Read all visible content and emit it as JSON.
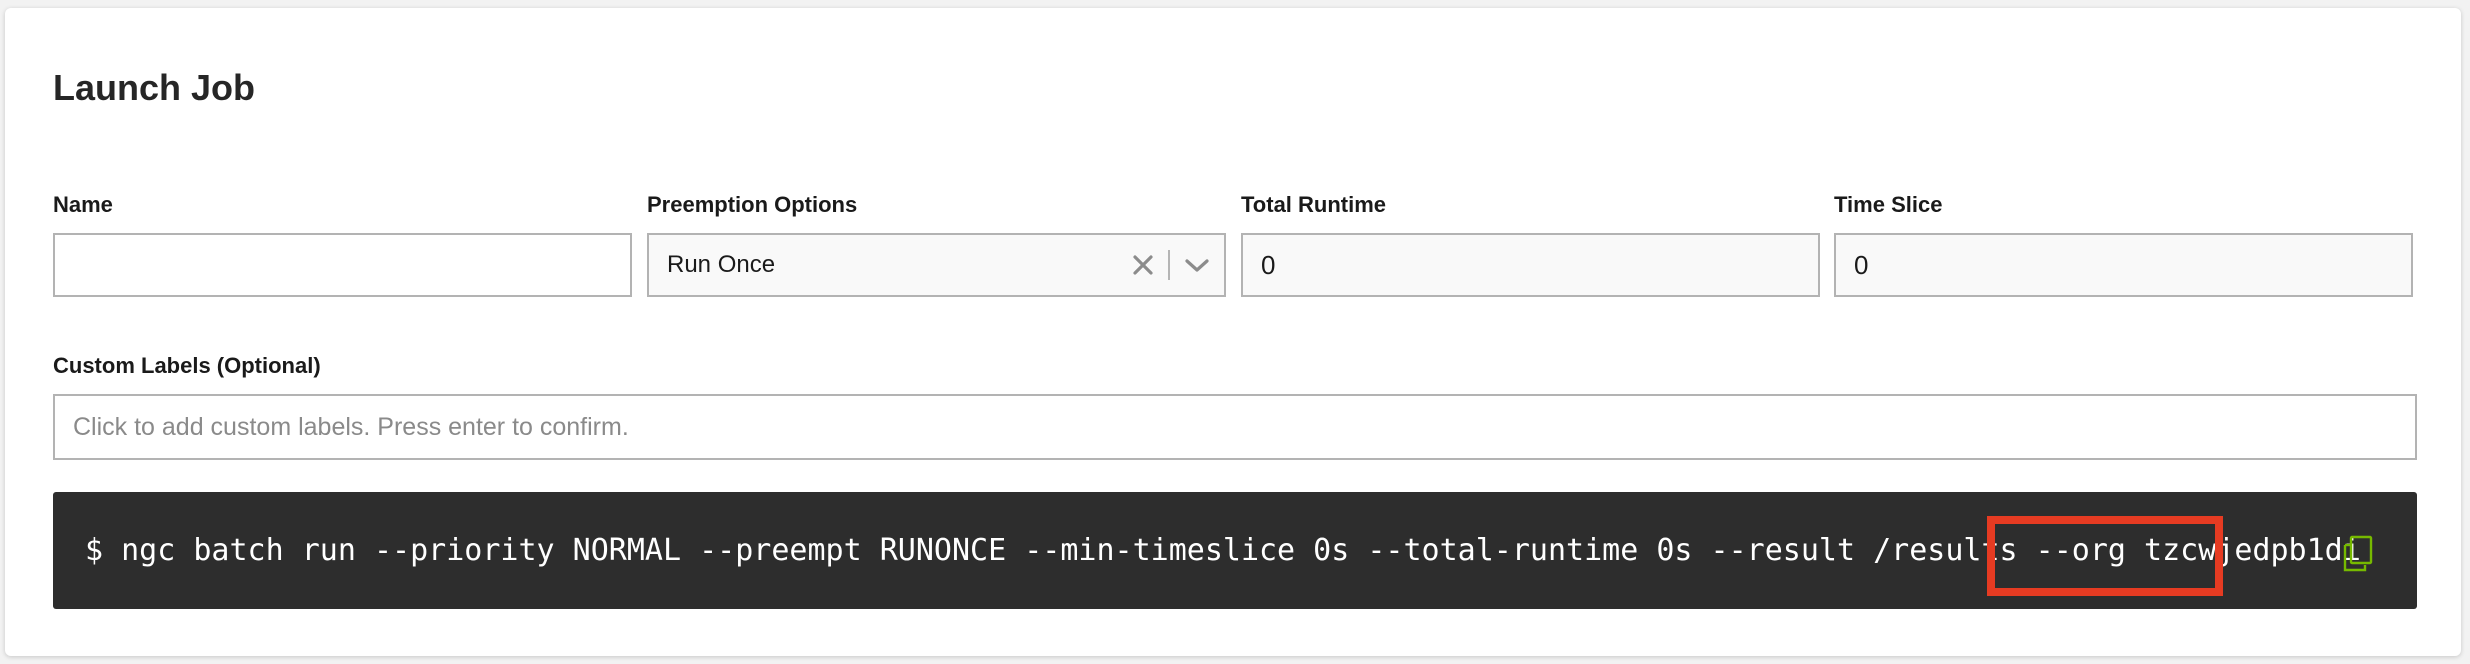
{
  "page": {
    "title": "Launch Job"
  },
  "fields": {
    "name": {
      "label": "Name",
      "value": ""
    },
    "preemption": {
      "label": "Preemption Options",
      "value": "Run Once"
    },
    "total_runtime": {
      "label": "Total Runtime",
      "value": "0"
    },
    "time_slice": {
      "label": "Time Slice",
      "value": "0"
    },
    "custom_labels": {
      "label": "Custom Labels (Optional)",
      "placeholder": "Click to add custom labels. Press enter to confirm."
    }
  },
  "cli": {
    "command": "$ ngc batch run --priority NORMAL --preempt RUNONCE --min-timeslice 0s --total-runtime 0s --result /results --org tzcwjedpb1di"
  },
  "icons": {
    "clear": "close-icon",
    "dropdown": "chevron-down-icon",
    "copy": "copy-icon"
  },
  "colors": {
    "cli_background": "#2d2d2d",
    "copy_icon": "#76b900",
    "highlight": "#e63b22"
  }
}
